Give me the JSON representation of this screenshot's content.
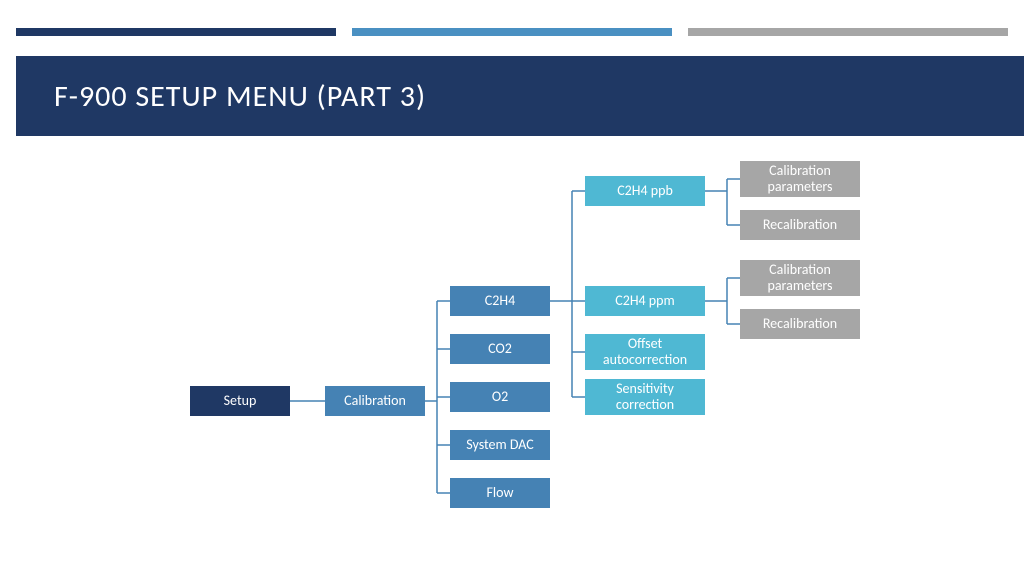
{
  "title": "F-900 SETUP MENU (PART 3)",
  "nodes": {
    "setup": "Setup",
    "calibration": "Calibration",
    "c2h4": "C2H4",
    "co2": "CO2",
    "o2": "O2",
    "system_dac": "System DAC",
    "flow": "Flow",
    "c2h4_ppb": "C2H4 ppb",
    "c2h4_ppm": "C2H4 ppm",
    "offset_autocorrection": "Offset autocorrection",
    "sensitivity_correction": "Sensitivity correction",
    "cal_params_1": "Calibration parameters",
    "recal_1": "Recalibration",
    "cal_params_2": "Calibration parameters",
    "recal_2": "Recalibration"
  }
}
